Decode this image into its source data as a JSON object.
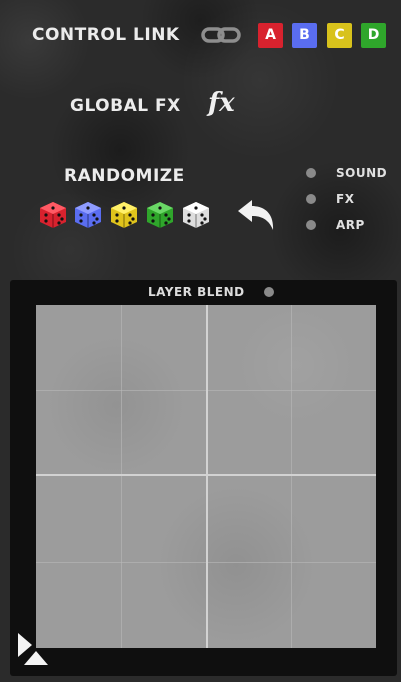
{
  "control_link": {
    "label": "CONTROL LINK",
    "link_icon": "chain-link-icon",
    "buttons": [
      {
        "label": "A",
        "color": "#d8222e"
      },
      {
        "label": "B",
        "color": "#5a6df0"
      },
      {
        "label": "C",
        "color": "#d8c21c"
      },
      {
        "label": "D",
        "color": "#2fa62b"
      }
    ]
  },
  "global_fx": {
    "label": "GLOBAL FX",
    "button_label": "fx"
  },
  "randomize": {
    "label": "RANDOMIZE",
    "dice": [
      {
        "name": "red-die-icon",
        "color": "#d8222e"
      },
      {
        "name": "blue-die-icon",
        "color": "#5a6df0"
      },
      {
        "name": "yellow-die-icon",
        "color": "#e0c41c"
      },
      {
        "name": "green-die-icon",
        "color": "#2fa62b"
      },
      {
        "name": "white-die-icon",
        "color": "#eeeeee"
      }
    ],
    "undo_icon": "undo-arrow-icon",
    "options": [
      {
        "label": "SOUND"
      },
      {
        "label": "FX"
      },
      {
        "label": "ARP"
      }
    ]
  },
  "layer_blend": {
    "label": "LAYER BLEND"
  }
}
